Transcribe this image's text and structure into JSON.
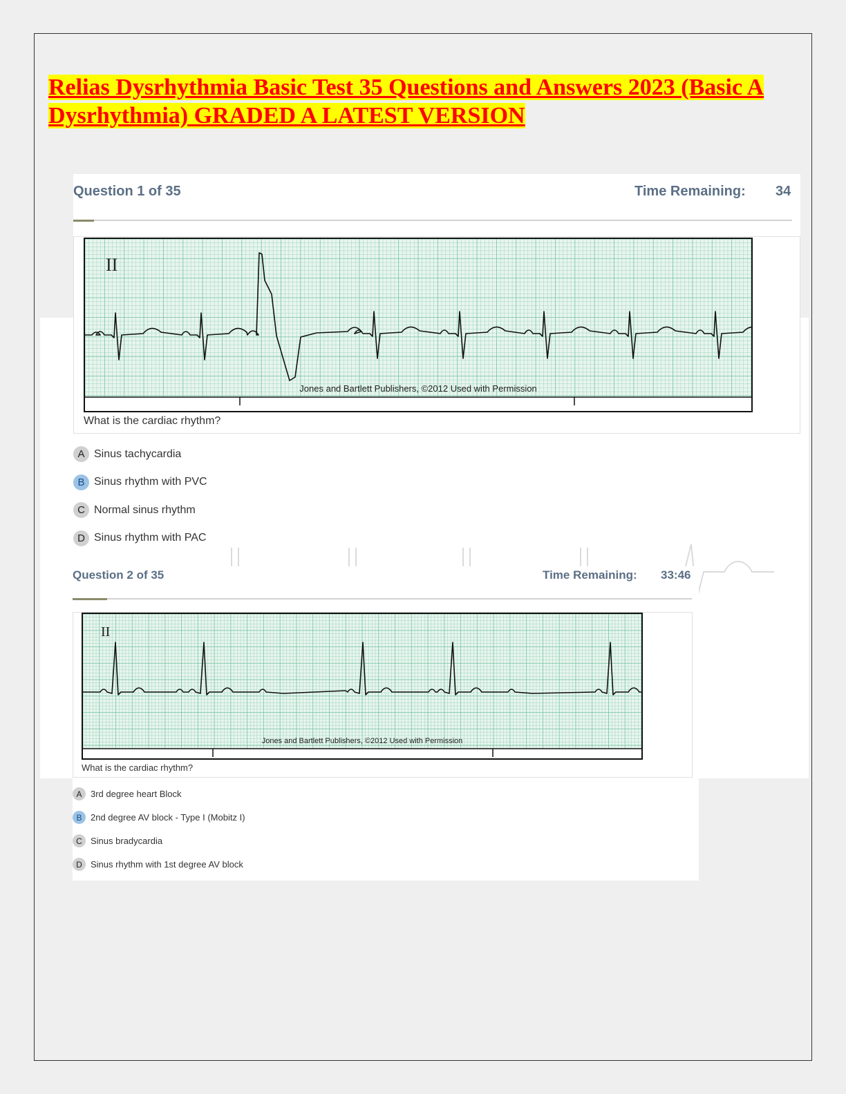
{
  "document": {
    "title": "Relias Dysrhythmia Basic Test 35 Questions and Answers 2023 (Basic A Dysrhythmia) GRADED A LATEST VERSION"
  },
  "questions": [
    {
      "number_label": "Question 1 of 35",
      "time_label": "Time Remaining:",
      "time_value": "34",
      "lead_label": "II",
      "copyright": "Jones and Bartlett Publishers, ©2012 Used with Permission",
      "prompt": "What is the cardiac rhythm?",
      "options": [
        {
          "letter": "A",
          "text": "Sinus tachycardia",
          "selected": false
        },
        {
          "letter": "B",
          "text": "Sinus rhythm with PVC",
          "selected": true
        },
        {
          "letter": "C",
          "text": "Normal sinus rhythm",
          "selected": false
        },
        {
          "letter": "D",
          "text": "Sinus rhythm with PAC",
          "selected": false
        }
      ]
    },
    {
      "number_label": "Question 2 of 35",
      "time_label": "Time Remaining:",
      "time_value": "33:46",
      "lead_label": "II",
      "copyright": "Jones and Bartlett Publishers, ©2012 Used with Permission",
      "prompt": "What is the cardiac rhythm?",
      "options": [
        {
          "letter": "A",
          "text": "3rd degree heart Block",
          "selected": false
        },
        {
          "letter": "B",
          "text": "2nd degree AV block - Type I (Mobitz I)",
          "selected": true
        },
        {
          "letter": "C",
          "text": "Sinus bradycardia",
          "selected": false
        },
        {
          "letter": "D",
          "text": "Sinus rhythm with 1st degree AV block",
          "selected": false
        }
      ]
    }
  ],
  "colors": {
    "title_text": "#ff0000",
    "title_highlight": "#ffff00",
    "header_text": "#5b6f85",
    "ecg_grid": "#7fc8a9",
    "selected_option": "#9cc3e6"
  }
}
